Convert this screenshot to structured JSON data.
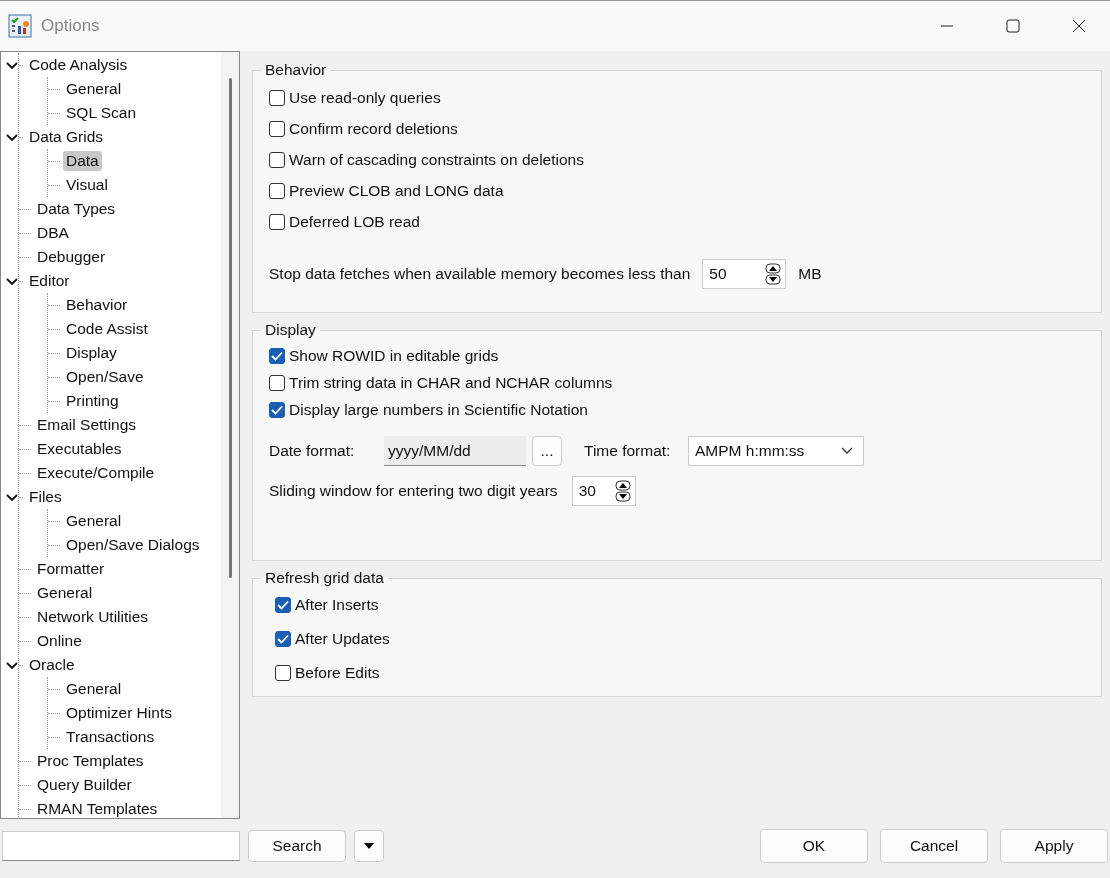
{
  "window": {
    "title": "Options"
  },
  "tree": [
    {
      "label": "Code Analysis",
      "expanded": true,
      "selected": false,
      "children": [
        {
          "label": "General",
          "selected": false
        },
        {
          "label": "SQL Scan",
          "selected": false
        }
      ]
    },
    {
      "label": "Data Grids",
      "expanded": true,
      "selected": false,
      "children": [
        {
          "label": "Data",
          "selected": true
        },
        {
          "label": "Visual",
          "selected": false
        }
      ]
    },
    {
      "label": "Data Types",
      "selected": false
    },
    {
      "label": "DBA",
      "selected": false
    },
    {
      "label": "Debugger",
      "selected": false
    },
    {
      "label": "Editor",
      "expanded": true,
      "selected": false,
      "children": [
        {
          "label": "Behavior",
          "selected": false
        },
        {
          "label": "Code Assist",
          "selected": false
        },
        {
          "label": "Display",
          "selected": false
        },
        {
          "label": "Open/Save",
          "selected": false
        },
        {
          "label": "Printing",
          "selected": false
        }
      ]
    },
    {
      "label": "Email Settings",
      "selected": false
    },
    {
      "label": "Executables",
      "selected": false
    },
    {
      "label": "Execute/Compile",
      "selected": false
    },
    {
      "label": "Files",
      "expanded": true,
      "selected": false,
      "children": [
        {
          "label": "General",
          "selected": false
        },
        {
          "label": "Open/Save Dialogs",
          "selected": false
        }
      ]
    },
    {
      "label": "Formatter",
      "selected": false
    },
    {
      "label": "General",
      "selected": false
    },
    {
      "label": "Network Utilities",
      "selected": false
    },
    {
      "label": "Online",
      "selected": false
    },
    {
      "label": "Oracle",
      "expanded": true,
      "selected": false,
      "children": [
        {
          "label": "General",
          "selected": false
        },
        {
          "label": "Optimizer Hints",
          "selected": false
        },
        {
          "label": "Transactions",
          "selected": false
        }
      ]
    },
    {
      "label": "Proc Templates",
      "selected": false
    },
    {
      "label": "Query Builder",
      "selected": false
    },
    {
      "label": "RMAN Templates",
      "selected": false
    }
  ],
  "behavior": {
    "title": "Behavior",
    "checkboxes": [
      {
        "label": "Use read-only queries",
        "checked": false
      },
      {
        "label": "Confirm record deletions",
        "checked": false
      },
      {
        "label": "Warn of cascading constraints on deletions",
        "checked": false
      },
      {
        "label": "Preview CLOB and LONG data",
        "checked": false
      },
      {
        "label": "Deferred LOB read",
        "checked": false
      }
    ],
    "memory": {
      "label": "Stop data fetches when available memory becomes less than",
      "value": "50",
      "unit": "MB"
    }
  },
  "display": {
    "title": "Display",
    "checkboxes": [
      {
        "label": "Show ROWID in editable grids",
        "checked": true
      },
      {
        "label": "Trim string data in CHAR and NCHAR columns",
        "checked": false
      },
      {
        "label": "Display large numbers in Scientific Notation",
        "checked": true
      }
    ],
    "date_format": {
      "label": "Date format:",
      "value": "yyyy/MM/dd",
      "button": "..."
    },
    "time_format": {
      "label": "Time format:",
      "value": "AMPM h:mm:ss"
    },
    "sliding_window": {
      "label": "Sliding window for entering two digit years",
      "value": "30"
    }
  },
  "refresh": {
    "title": "Refresh grid data",
    "checkboxes": [
      {
        "label": "After Inserts",
        "checked": true
      },
      {
        "label": "After Updates",
        "checked": true
      },
      {
        "label": "Before Edits",
        "checked": false
      }
    ]
  },
  "footer": {
    "search_button": "Search",
    "buttons": [
      "OK",
      "Cancel",
      "Apply"
    ]
  }
}
